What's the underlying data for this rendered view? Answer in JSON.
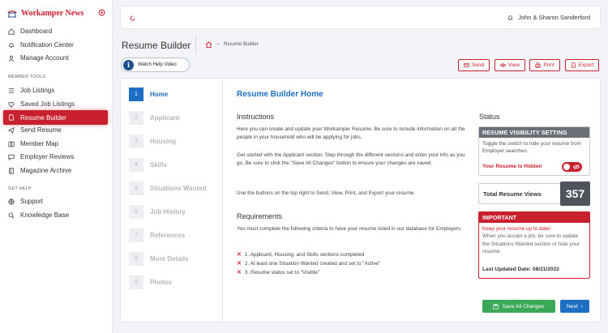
{
  "app": {
    "logo_text": "Workamper News"
  },
  "colors": {
    "brand": "#c8202f",
    "accent": "#1e6fc3",
    "success": "#3aa857"
  },
  "sidebar": {
    "items_top": [
      {
        "label": "Dashboard",
        "icon": "dashboard-icon"
      },
      {
        "label": "Notification Center",
        "icon": "bell-icon"
      },
      {
        "label": "Manage Account",
        "icon": "user-icon"
      }
    ],
    "section_member": "MEMBER TOOLS",
    "items_member": [
      {
        "label": "Job Listings",
        "icon": "list-icon"
      },
      {
        "label": "Saved Job Listings",
        "icon": "heart-icon"
      },
      {
        "label": "Resume Builder",
        "icon": "document-icon"
      },
      {
        "label": "Send Resume",
        "icon": "paper-plane-icon"
      },
      {
        "label": "Member Map",
        "icon": "map-icon"
      },
      {
        "label": "Employer Reviews",
        "icon": "comment-icon"
      },
      {
        "label": "Magazine Archive",
        "icon": "book-icon"
      }
    ],
    "section_help": "GET HELP",
    "items_help": [
      {
        "label": "Support",
        "icon": "globe-icon"
      },
      {
        "label": "Knowledge Base",
        "icon": "search-icon"
      }
    ]
  },
  "header": {
    "user_name": "John & Sharon Sanderford"
  },
  "page": {
    "title": "Resume Builder",
    "breadcrumb": "Resume Builder",
    "help_button": "Watch Help Video",
    "actions": [
      "Send",
      "View",
      "Print",
      "Export"
    ]
  },
  "steps": [
    {
      "num": "1",
      "label": "Home"
    },
    {
      "num": "2",
      "label": "Applicant"
    },
    {
      "num": "3",
      "label": "Housing"
    },
    {
      "num": "4",
      "label": "Skills"
    },
    {
      "num": "5",
      "label": "Situations Wanted"
    },
    {
      "num": "6",
      "label": "Job History"
    },
    {
      "num": "7",
      "label": "References"
    },
    {
      "num": "8",
      "label": "More Details"
    },
    {
      "num": "9",
      "label": "Photos"
    }
  ],
  "main": {
    "heading": "Resume Builder Home",
    "instructions_title": "Instructions",
    "instructions_p1": "Here you can create and update your Workamper Resume.  Be sure to include information on all the people in your household who will be applying for jobs.",
    "instructions_p2": "Get started with the Applicant section. Step through the different sections and enter your info as you go.  Be sure to click the \"Save All Changes\" button to ensure your changes are saved.",
    "instructions_p3": "Use the buttons on the top right to Send, View, Print, and Export your resume.",
    "requirements_title": "Requirements",
    "requirements_intro": "You must complete the following criteria to have your resume listed in our database for Employers.",
    "requirements": [
      "1. Applicant, Housing, and Skills sections completed",
      "2. At least one Situation Wanted created and set to \"Active\"",
      "3. Resume status set to \"Visible\""
    ]
  },
  "status": {
    "title": "Status",
    "visibility_header": "RESUME VISIBILITY SETTING",
    "visibility_text": "Toggle the switch to hide your resume from Employer searches.",
    "hidden_label": "Your Resume Is Hidden",
    "views_label": "Total Resume Views",
    "views_count": "357",
    "important_header": "IMPORTANT",
    "important_line1": "Keep your resume up to date!",
    "important_line2": "When you accept a job, be sure to update the Situations Wanted section or hide your resume.",
    "last_updated": "Last Updated Date: 08/21/2022"
  },
  "footer": {
    "save_label": "Save All Changes",
    "next_label": "Next"
  }
}
